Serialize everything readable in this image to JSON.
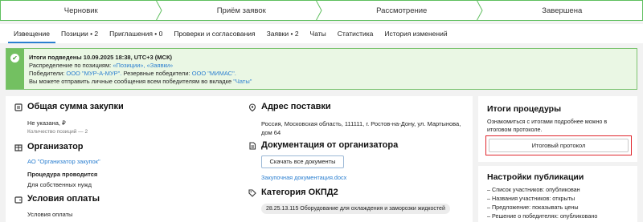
{
  "stepper": {
    "steps": [
      "Черновик",
      "Приём заявок",
      "Рассмотрение",
      "Завершена"
    ]
  },
  "tabs": [
    "Извещение",
    "Позиции • 2",
    "Приглашения • 0",
    "Проверки и согласования",
    "Заявки • 2",
    "Чаты",
    "Статистика",
    "История изменений"
  ],
  "notice": {
    "title": "Итоги подведены 10.09.2025 18:38, UTC+3 (МСК)",
    "l1_prefix": "Распределение по позициям:",
    "l1_link1": "«Позиции»,",
    "l1_link2": "«Заявки»",
    "l2_prefix": "Победители:",
    "l2_winner": "ООО \"МУР-А-МУР\".",
    "l2_mid": "Резервные победители:",
    "l2_reserve": "ООО \"МИМАС\".",
    "l3_prefix": "Вы можете отправить личные сообщения всем победителям во вкладке",
    "l3_link": "\"Чаты\""
  },
  "left": {
    "total_title": "Общая сумма закупки",
    "total_value": "Не указана, ₽",
    "positions_count": "Количество позиций — 2",
    "org_title": "Организатор",
    "org_link": "АО \"Организатор закупок\"",
    "proc_title": "Процедура проводится",
    "proc_value": "Для собственных нужд",
    "pay_title": "Условия оплаты",
    "pay_value": "Условия оплаты",
    "addr_title": "Адрес поставки",
    "addr_value": "Россия, Московская область, 111111, г. Ростов-на-Дону, ул. Мартынова, дом 64",
    "docs_title": "Документация от организатора",
    "download_btn": "Скачать все документы",
    "doc_link": "Закупочная документация.docx",
    "okpd_title": "Категория ОКПД2",
    "okpd_tag": "28.25.13.115 Оборудование для охлаждения и заморозки жидкостей"
  },
  "results": {
    "title": "Итоги процедуры",
    "text": "Ознакомиться с итогами подробнее можно в итоговом протоколе.",
    "btn": "Итоговый протокол"
  },
  "publication": {
    "title": "Настройки публикации",
    "items": [
      "Список участников: опубликован",
      "Названия участников: открыты",
      "Предложение: показывать цены",
      "Решение о победителях: опубликовано"
    ]
  },
  "colors": {
    "accent": "#2b7fd0",
    "success": "#73c061",
    "highlight": "#e0262d"
  }
}
